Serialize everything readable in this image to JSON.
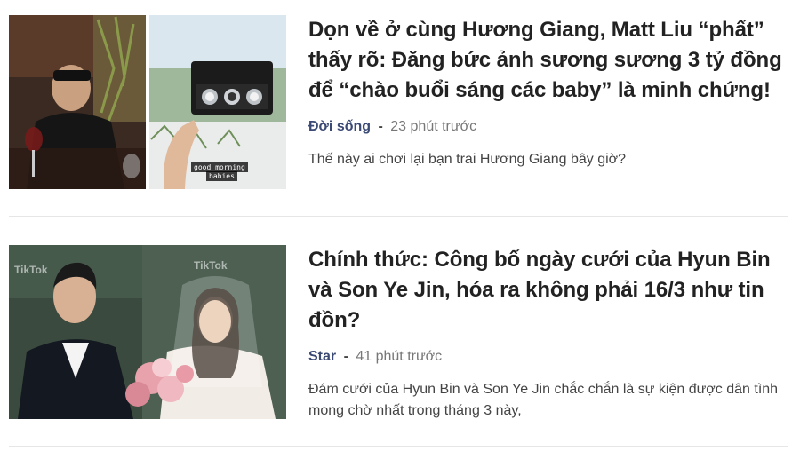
{
  "articles": [
    {
      "title": "Dọn về ở cùng Hương Giang, Matt Liu “phất” thấy rõ: Đăng bức ảnh sương sương 3 tỷ đồng để “chào buổi sáng các baby” là minh chứng!",
      "category": "Đời sống",
      "separator": "-",
      "time": "23 phút trước",
      "sapo": "Thế này ai chơi lại bạn trai Hương Giang bây giờ?",
      "image_caption_lines": [
        "good morning",
        "babies"
      ]
    },
    {
      "title": "Chính thức: Công bố ngày cưới của Hyun Bin và Son Ye Jin, hóa ra không phải 16/3 như tin đồn?",
      "category": "Star",
      "separator": "-",
      "time": "41 phút trước",
      "sapo": "Đám cưới của Hyun Bin và Son Ye Jin chắc chắn là sự kiện được dân tình mong chờ nhất trong tháng 3 này,",
      "image_watermarks": [
        "TikTok",
        "TikTok"
      ]
    }
  ],
  "colors": {
    "category": "#3b4a75",
    "title": "#222222",
    "time": "#777777",
    "divider": "#e6e6e6"
  }
}
